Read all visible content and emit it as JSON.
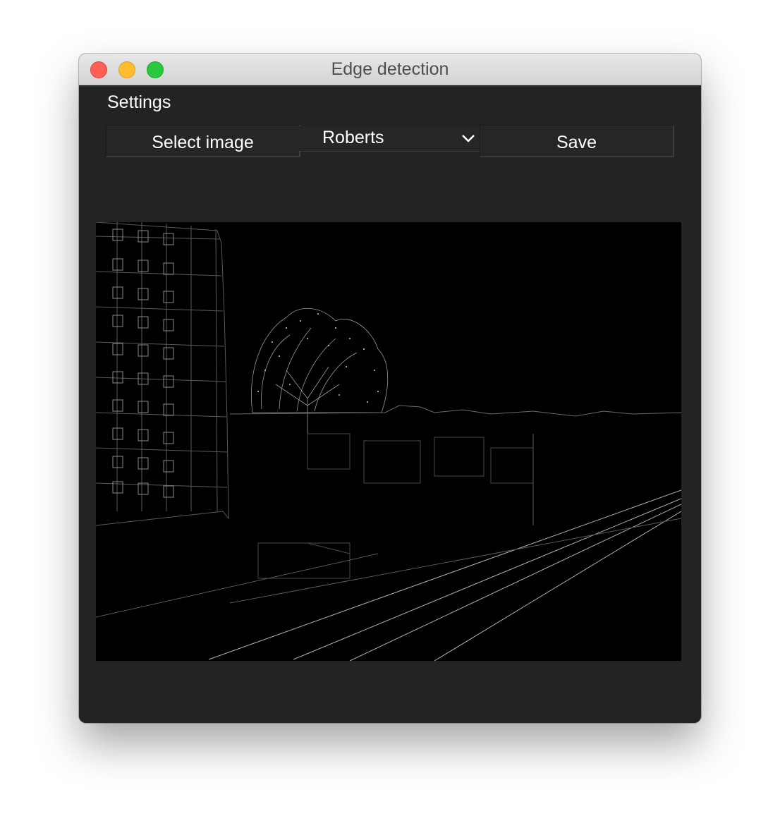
{
  "window": {
    "title": "Edge detection"
  },
  "settings": {
    "label": "Settings"
  },
  "toolbar": {
    "select_image_label": "Select image",
    "method_value": "Roberts",
    "save_label": "Save"
  },
  "icons": {
    "close": "close-icon",
    "minimize": "minimize-icon",
    "maximize": "maximize-icon",
    "dropdown": "chevron-down-icon"
  },
  "colors": {
    "window_bg": "#232323",
    "close": "#fe5f57",
    "minimize": "#febc2e",
    "maximize": "#28c840"
  }
}
